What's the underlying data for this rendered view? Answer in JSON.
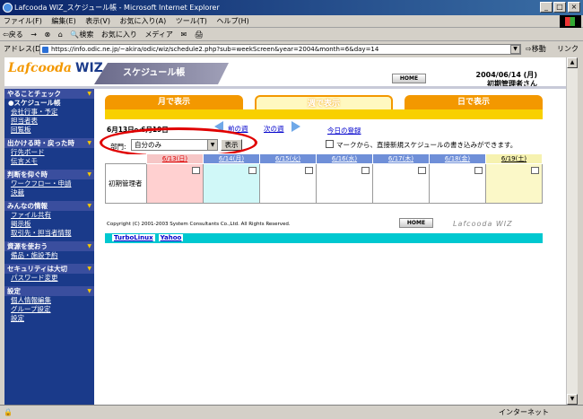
{
  "window": {
    "title": "Lafcooda WIZ_スケジュール帳 - Microsoft Internet Explorer",
    "min": "_",
    "max": "□",
    "close": "×"
  },
  "menu": [
    "ファイル(F)",
    "編集(E)",
    "表示(V)",
    "お気に入り(A)",
    "ツール(T)",
    "ヘルプ(H)"
  ],
  "toolbar": [
    "⇦戻る",
    "→",
    "⊗",
    "⌂",
    "🔍検索",
    "お気に入り",
    "メディア",
    "✉",
    "🖨"
  ],
  "address": {
    "label": "アドレス(D)",
    "url": "https://info.odic.ne.jp/~akira/odic/wiz/schedule2.php?sub=weekScreen&year=2004&month=6&day=14",
    "go": "⇨移動",
    "links": "リンク »"
  },
  "header": {
    "logo": "Lafcooda",
    "logo_wiz": "WIZ",
    "section": "スケジュール帳",
    "home": "HOME",
    "date": "2004/06/14 (月)",
    "user": "初期管理者さん"
  },
  "sidebar": [
    {
      "head": "やることチェック",
      "items": [
        "●スケジュール帳",
        "会社行事・予定",
        "担当者表",
        "回覧板"
      ]
    },
    {
      "head": "出かける時・戻った時",
      "items": [
        "行先ボード",
        "伝言メモ"
      ]
    },
    {
      "head": "判断を仰ぐ時",
      "items": [
        "ワークフロー・申請",
        "決裁"
      ]
    },
    {
      "head": "みんなの情報",
      "items": [
        "ファイル共有",
        "掲示板",
        "取引先・担当者情報"
      ]
    },
    {
      "head": "資源を使おう",
      "items": [
        "備品・施設予約"
      ]
    },
    {
      "head": "セキュリティは大切",
      "items": [
        "パスワード変更"
      ]
    },
    {
      "head": "設定",
      "items": [
        "個人情報編集",
        "グループ設定",
        "設定"
      ]
    }
  ],
  "tabs": {
    "month": "月で表示",
    "week": "週で表示",
    "day": "日で表示"
  },
  "range": "6月13日～6月19日",
  "prev_week": "前の週",
  "next_week": "次の週",
  "today_reg": "今日の登録",
  "notice": "マークから、直接新規スケジュールの書き込みができます。",
  "dept": {
    "label": "部門:",
    "value": "自分のみ",
    "button": "表示"
  },
  "grid": {
    "days": [
      "6/13(日)",
      "6/14(月)",
      "6/15(火)",
      "6/16(水)",
      "6/17(木)",
      "6/18(金)",
      "6/19(土)"
    ],
    "row": "初期管理者"
  },
  "footer": {
    "copyright": "Copyright (C) 2001-2003 System Consultants Co.,Ltd. All Rights Reserved.",
    "brand": "Lafcooda WIZ",
    "links": [
      "TurboLinux",
      "Yahoo"
    ]
  },
  "status": {
    "zone": "インターネット"
  },
  "colors": {
    "accent": "#f39800",
    "nav": "#1a3a8a",
    "link_bar": "#00c8d0"
  }
}
